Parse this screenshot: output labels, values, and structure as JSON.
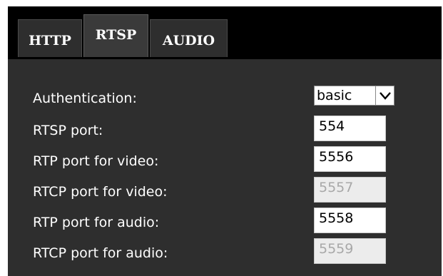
{
  "tabs": [
    {
      "label": "HTTP",
      "active": false
    },
    {
      "label": "RTSP",
      "active": true
    },
    {
      "label": "AUDIO",
      "active": false
    }
  ],
  "form": {
    "authentication": {
      "label": "Authentication:",
      "value": "basic"
    },
    "rtsp_port": {
      "label": "RTSP port:",
      "value": "554"
    },
    "rtp_video": {
      "label": "RTP port for video:",
      "value": "5556"
    },
    "rtcp_video": {
      "label": "RTCP port for video:",
      "value": "5557",
      "disabled": true
    },
    "rtp_audio": {
      "label": "RTP port for audio:",
      "value": "5558"
    },
    "rtcp_audio": {
      "label": "RTCP port for audio:",
      "value": "5559",
      "disabled": true
    }
  },
  "icons": {
    "dropdown": "chevron-down-icon"
  },
  "colors": {
    "background": "#000000",
    "panel": "#2e2e2e",
    "tab": "#2e2e2e",
    "text": "#ffffff",
    "disabled_field": "#ececec"
  }
}
